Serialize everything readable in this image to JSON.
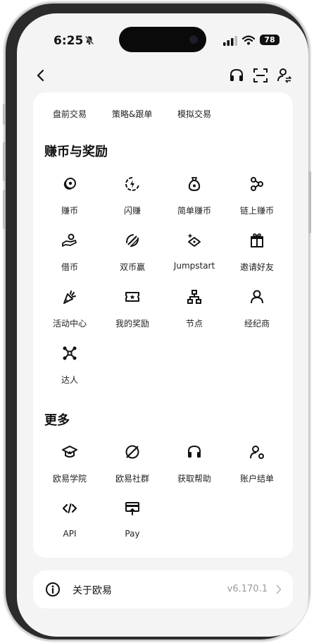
{
  "status_bar": {
    "time": "6:25",
    "battery": "78"
  },
  "tabs": [
    "盘前交易",
    "策略&跟单",
    "模拟交易"
  ],
  "sections": {
    "earn": {
      "title": "赚币与奖励",
      "items": [
        {
          "label": "赚币",
          "icon": "coins-icon"
        },
        {
          "label": "闪赚",
          "icon": "flash-earn-icon"
        },
        {
          "label": "简单赚币",
          "icon": "money-bag-icon"
        },
        {
          "label": "链上赚币",
          "icon": "onchain-icon"
        },
        {
          "label": "借币",
          "icon": "loan-icon"
        },
        {
          "label": "双币赢",
          "icon": "dual-coin-icon"
        },
        {
          "label": "Jumpstart",
          "icon": "jumpstart-icon"
        },
        {
          "label": "邀请好友",
          "icon": "gift-icon"
        },
        {
          "label": "活动中心",
          "icon": "party-icon"
        },
        {
          "label": "我的奖励",
          "icon": "ticket-icon"
        },
        {
          "label": "节点",
          "icon": "node-icon"
        },
        {
          "label": "经纪商",
          "icon": "broker-icon"
        },
        {
          "label": "达人",
          "icon": "network-icon"
        }
      ]
    },
    "more": {
      "title": "更多",
      "items": [
        {
          "label": "欧易学院",
          "icon": "academy-icon"
        },
        {
          "label": "欧易社群",
          "icon": "community-icon"
        },
        {
          "label": "获取帮助",
          "icon": "headset-icon"
        },
        {
          "label": "账户结单",
          "icon": "account-statement-icon"
        },
        {
          "label": "API",
          "icon": "code-icon"
        },
        {
          "label": "Pay",
          "icon": "pay-icon"
        }
      ]
    }
  },
  "about": {
    "label": "关于欧易",
    "version": "v6.170.1"
  }
}
